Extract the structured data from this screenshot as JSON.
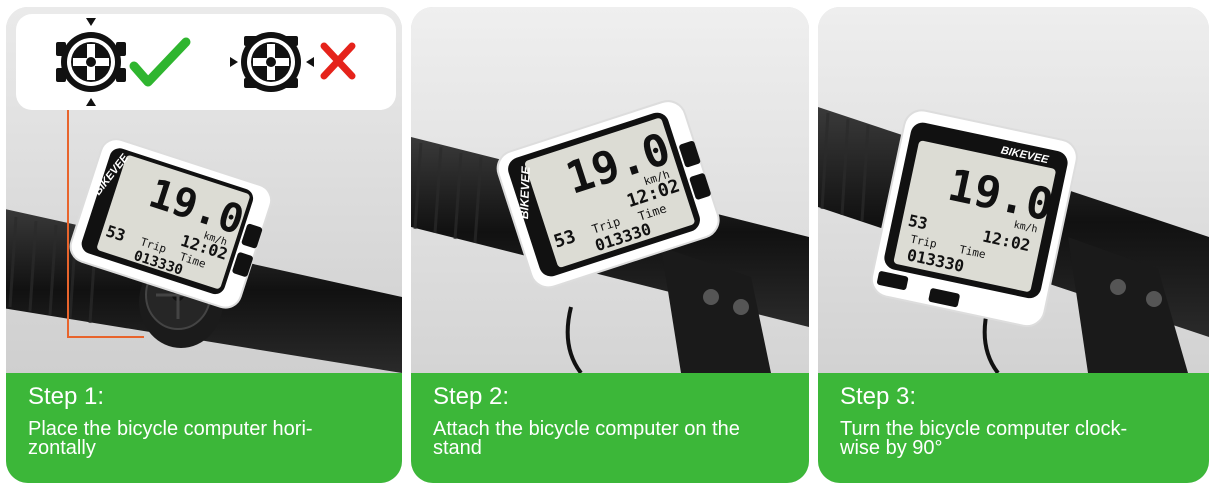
{
  "brand": "BIKEVEE",
  "display": {
    "speed": "19.0",
    "speed_unit": "km/h",
    "clock": "12:02",
    "temperature": "53",
    "label_trip": "Trip",
    "label_time": "Time",
    "odometer": "013330"
  },
  "steps": [
    {
      "step": "Step 1:",
      "text": "Place the bicycle computer hori-\nzontally"
    },
    {
      "step": "Step 2:",
      "text": "Attach the bicycle computer on the\nstand"
    },
    {
      "step": "Step 3:",
      "text": "Turn the bicycle computer clock-\nwise by 90°"
    }
  ],
  "icons": {
    "correct": "check-icon",
    "wrong": "cross-icon"
  },
  "colors": {
    "caption_green": "#3cb739",
    "check_green": "#2fb52f",
    "cross_red": "#e5231b",
    "leader_line": "#e8642c"
  }
}
